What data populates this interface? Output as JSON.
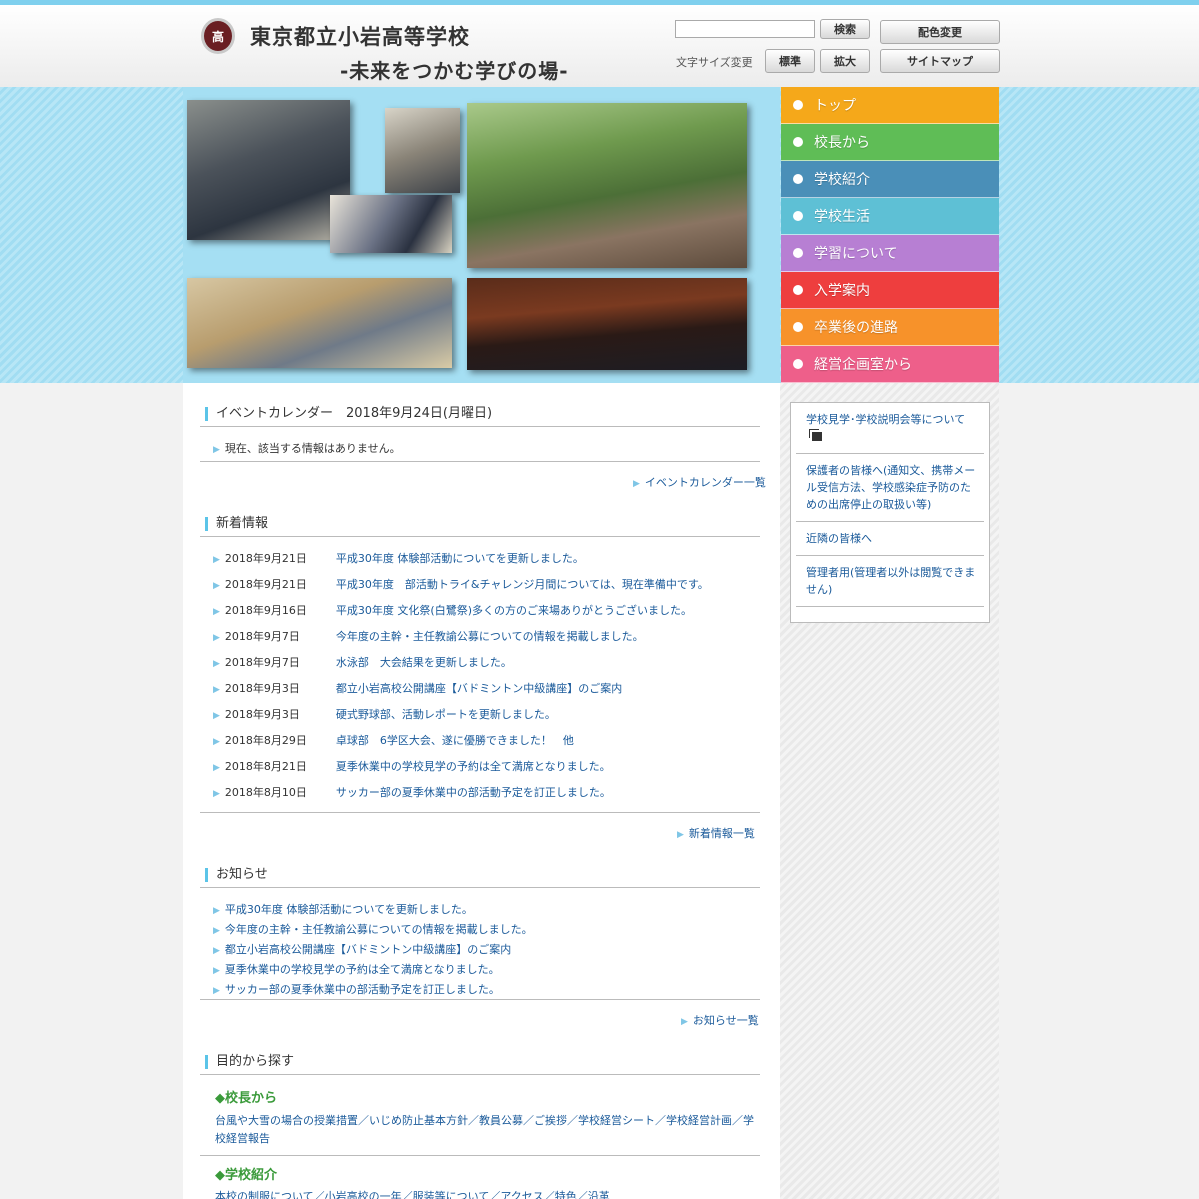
{
  "header": {
    "logo_text": "高",
    "title": "東京都立小岩高等学校",
    "subtitle": "-未来をつかむ学びの場-",
    "search_placeholder": "",
    "search_button": "検索",
    "color_button": "配色変更",
    "font_size_label": "文字サイズ変更",
    "font_std_button": "標準",
    "font_big_button": "拡大",
    "sitemap_button": "サイトマップ"
  },
  "global_nav": [
    {
      "label": "トップ",
      "color": "#f5a81a"
    },
    {
      "label": "校長から",
      "color": "#5fbd56"
    },
    {
      "label": "学校紹介",
      "color": "#4a8fb8"
    },
    {
      "label": "学校生活",
      "color": "#5ec0d5"
    },
    {
      "label": "学習について",
      "color": "#b77fd3"
    },
    {
      "label": "入学案内",
      "color": "#ee3e3e"
    },
    {
      "label": "卒業後の進路",
      "color": "#f7922a"
    },
    {
      "label": "経営企画室から",
      "color": "#ee5f8a"
    }
  ],
  "event_calendar": {
    "heading": "イベントカレンダー　2018年9月24日(月曜日)",
    "empty_text": "現在、該当する情報はありません。",
    "more_link": "イベントカレンダー一覧"
  },
  "news": {
    "heading": "新着情報",
    "items": [
      {
        "date": "2018年9月21日",
        "title": "平成30年度 体験部活動についてを更新しました。"
      },
      {
        "date": "2018年9月21日",
        "title": "平成30年度　部活動トライ&チャレンジ月間については、現在準備中です。"
      },
      {
        "date": "2018年9月16日",
        "title": "平成30年度 文化祭(白鷺祭)多くの方のご来場ありがとうございました。"
      },
      {
        "date": "2018年9月7日",
        "title": "今年度の主幹・主任教諭公募についての情報を掲載しました。"
      },
      {
        "date": "2018年9月7日",
        "title": "水泳部　大会結果を更新しました。"
      },
      {
        "date": "2018年9月3日",
        "title": "都立小岩高校公開講座【バドミントン中級講座】のご案内"
      },
      {
        "date": "2018年9月3日",
        "title": "硬式野球部、活動レポートを更新しました。"
      },
      {
        "date": "2018年8月29日",
        "title": "卓球部　6学区大会、遂に優勝できました！　他"
      },
      {
        "date": "2018年8月21日",
        "title": "夏季休業中の学校見学の予約は全て満席となりました。"
      },
      {
        "date": "2018年8月10日",
        "title": "サッカー部の夏季休業中の部活動予定を訂正しました。"
      }
    ],
    "more_link": "新着情報一覧"
  },
  "notices": {
    "heading": "お知らせ",
    "items": [
      "平成30年度 体験部活動についてを更新しました。",
      "今年度の主幹・主任教諭公募についての情報を掲載しました。",
      "都立小岩高校公開講座【バドミントン中級講座】のご案内",
      "夏季休業中の学校見学の予約は全て満席となりました。",
      "サッカー部の夏季休業中の部活動予定を訂正しました。"
    ],
    "more_link": "お知らせ一覧"
  },
  "purpose": {
    "heading": "目的から探す",
    "groups": [
      {
        "title": "◆校長から",
        "links": "台風や大雪の場合の授業措置／いじめ防止基本方針／教員公募／ご挨拶／学校経営シート／学校経営計画／学校経営報告"
      },
      {
        "title": "◆学校紹介",
        "links": "本校の制服について／小岩高校の一年／服装等について／アクセス／特色／沿革"
      }
    ]
  },
  "sidebar": [
    "学校見学･学校説明会等について",
    "保護者の皆様へ(通知文、携帯メール受信方法、学校感染症予防のための出席停止の取扱い等)",
    "近隣の皆様へ",
    "管理者用(管理者以外は閲覧できません)"
  ]
}
